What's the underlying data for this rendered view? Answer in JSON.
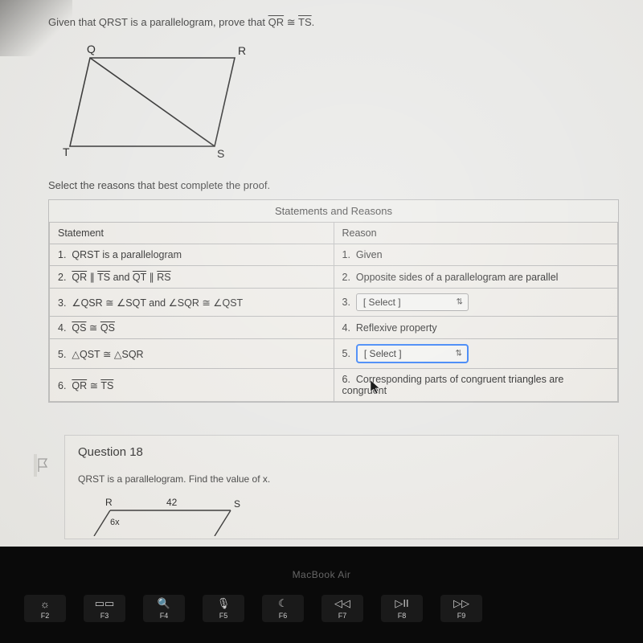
{
  "prompt_prefix": "Given that QRST is a parallelogram, prove that ",
  "prompt_seg1": "QR",
  "prompt_cong": " ≅ ",
  "prompt_seg2": "TS",
  "prompt_suffix": ".",
  "figure": {
    "labels": {
      "Q": "Q",
      "R": "R",
      "T": "T",
      "S": "S"
    }
  },
  "instruction": "Select the reasons that best complete the proof.",
  "table": {
    "title": "Statements and Reasons",
    "headers": {
      "statement": "Statement",
      "reason": "Reason"
    },
    "rows": [
      {
        "n": "1.",
        "stmt_plain": "QRST is a parallelogram",
        "reason": "Given",
        "rtype": "text"
      },
      {
        "n": "2.",
        "stmt_html": "QR_TS_QT_RS",
        "reason": "Opposite sides of a parallelogram are parallel",
        "rtype": "text"
      },
      {
        "n": "3.",
        "stmt_html": "angles3",
        "reason": "[ Select ]",
        "rtype": "select"
      },
      {
        "n": "4.",
        "stmt_html": "QS_QS",
        "reason": "Reflexive property",
        "rtype": "text"
      },
      {
        "n": "5.",
        "stmt_html": "tri5",
        "reason": "[ Select ]",
        "rtype": "select_active"
      },
      {
        "n": "6.",
        "stmt_html": "QR_TS",
        "reason": "Corresponding parts of congruent triangles are congruent",
        "rtype": "text"
      }
    ]
  },
  "q18": {
    "title": "Question 18",
    "sub": "QRST is a parallelogram. Find the value of x.",
    "top_len": "42",
    "R": "R",
    "S": "S"
  },
  "laptop": {
    "brand": "MacBook Air",
    "keys": [
      {
        "sym": "☀",
        "label": "F2"
      },
      {
        "sym": "⌕",
        "label": "F3",
        "top": "90"
      },
      {
        "sym": "Q",
        "label": "F4",
        "actually_sym": "🔍"
      },
      {
        "sym": "🎤",
        "label": "F5"
      },
      {
        "sym": "☾",
        "label": "F6"
      },
      {
        "sym": "⏮",
        "label": "F7"
      },
      {
        "sym": "⏯",
        "label": "F8"
      },
      {
        "sym": "⏭",
        "label": "F9"
      }
    ]
  }
}
